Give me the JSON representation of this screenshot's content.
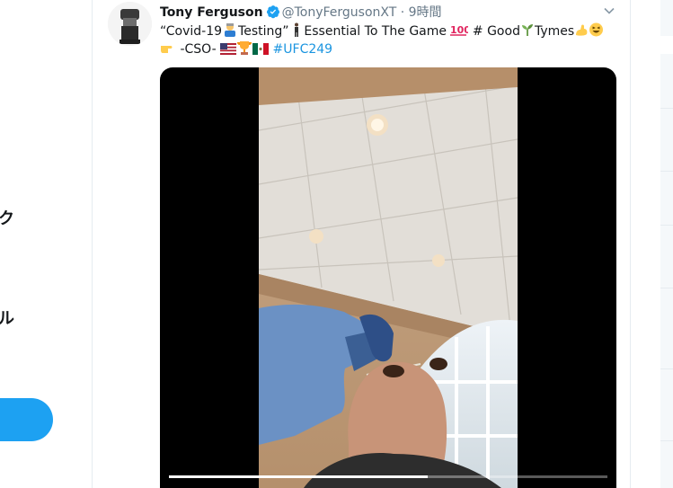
{
  "left_nav": {
    "items": [
      {
        "label": "ク"
      },
      {
        "label": "ル"
      }
    ]
  },
  "tweet": {
    "author_name": "Tony Ferguson",
    "handle": "@TonyFergusonXT",
    "separator": "·",
    "timestamp": "9時間",
    "text_line1": {
      "part1": "“Covid-19",
      "part2": "Testing”",
      "part3": "Essential To The Game",
      "part4": "# Good",
      "part5": "Tymes"
    },
    "text_line2": {
      "part1": "-CSO-",
      "hashtag": "#UFC249"
    },
    "icons": {
      "verified": "verified-badge-icon",
      "caret": "chevron-down-icon"
    },
    "video": {
      "progress": 0.59
    }
  },
  "colors": {
    "accent": "#1da1f2",
    "hashtag": "#1b95e0",
    "muted": "#657786",
    "border": "#e6ecf0"
  }
}
